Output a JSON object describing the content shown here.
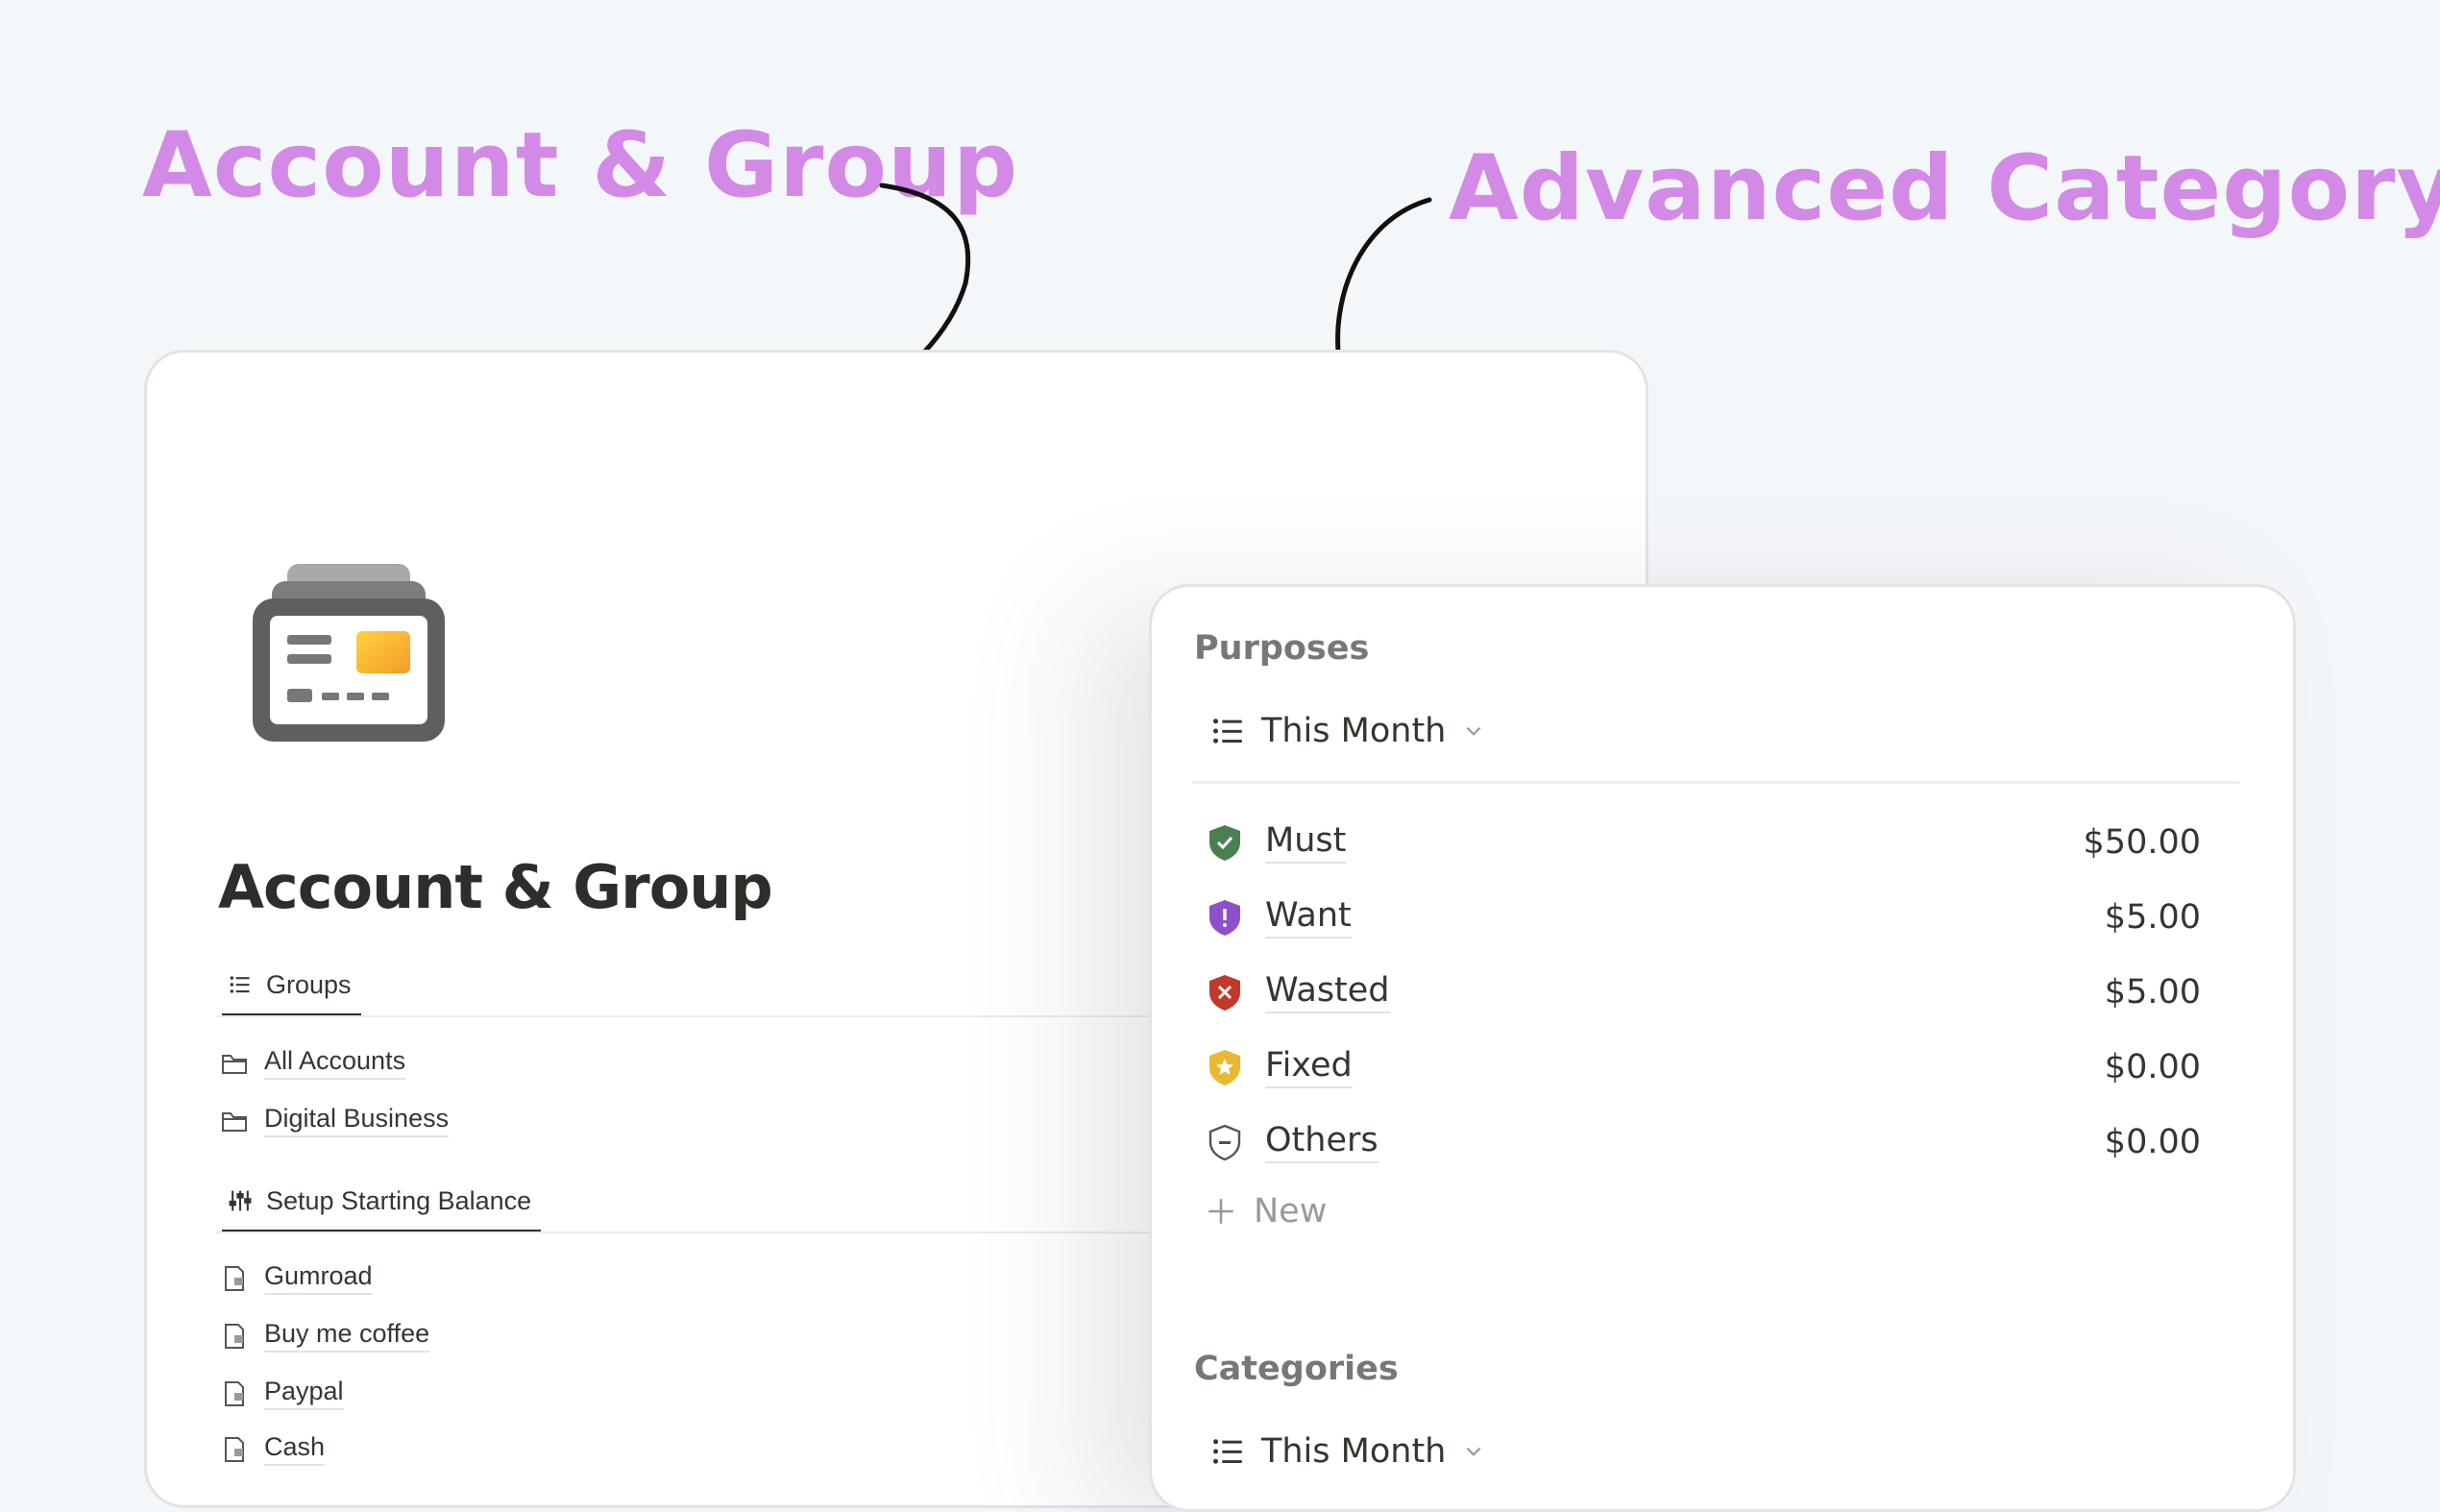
{
  "headlines": {
    "left": "Account & Group",
    "right": "Advanced Category"
  },
  "account_page": {
    "title": "Account & Group",
    "groups_tab": {
      "label": "Groups",
      "icon": "list-icon"
    },
    "groups": [
      {
        "label": "All Accounts",
        "icon": "folder-icon"
      },
      {
        "label": "Digital Business",
        "icon": "folder-icon"
      }
    ],
    "setup_tab": {
      "label": "Setup Starting Balance",
      "icon": "sliders-icon"
    },
    "accounts": [
      {
        "label": "Gumroad",
        "icon": "page-icon"
      },
      {
        "label": "Buy me coffee",
        "icon": "page-icon"
      },
      {
        "label": "Paypal",
        "icon": "page-icon"
      },
      {
        "label": "Cash",
        "icon": "page-icon"
      }
    ]
  },
  "category_page": {
    "purposes_label": "Purposes",
    "purposes_view": "This Month",
    "purposes": [
      {
        "name": "Must",
        "amount": "$50.00",
        "icon": "check-shield-icon",
        "color": "#4a7f52"
      },
      {
        "name": "Want",
        "amount": "$5.00",
        "icon": "exclamation-shield-icon",
        "color": "#8e4fc9"
      },
      {
        "name": "Wasted",
        "amount": "$5.00",
        "icon": "x-shield-icon",
        "color": "#c0392b"
      },
      {
        "name": "Fixed",
        "amount": "$0.00",
        "icon": "star-shield-icon",
        "color": "#e8b931"
      },
      {
        "name": "Others",
        "amount": "$0.00",
        "icon": "minus-shield-icon",
        "color": "#55534e"
      }
    ],
    "new_label": "New",
    "categories_label": "Categories",
    "categories_view": "This Month"
  },
  "colors": {
    "headline": "#d38ae6",
    "background": "#f4f7fa"
  }
}
